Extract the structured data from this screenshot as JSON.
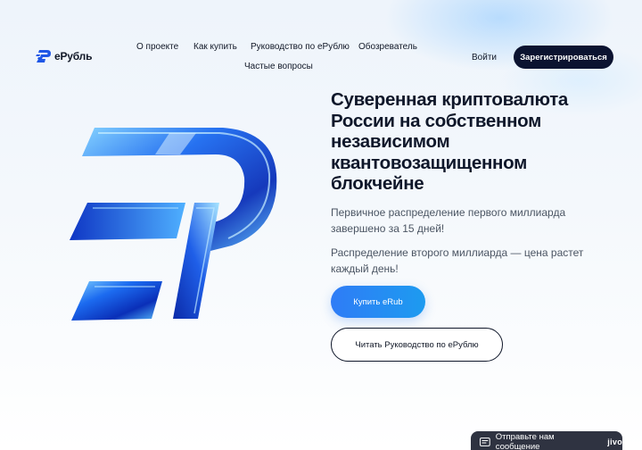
{
  "brand": {
    "name": "еРубль"
  },
  "nav": {
    "items": [
      {
        "label": "О проекте"
      },
      {
        "label": "Как купить"
      },
      {
        "label": "Руководство по еРублю"
      },
      {
        "label": "Обозреватель"
      },
      {
        "label": "Частые вопросы"
      }
    ],
    "login": "Войти",
    "register": "Зарегистрироваться"
  },
  "hero": {
    "headline": "Суверенная криптовалюта России на собственном независимом квантовозащищенном блокчейне",
    "paragraph1": "Первичное распределение первого миллиарда завершено за 15 дней!",
    "paragraph2": "Распределение второго миллиарда — цена растет каждый день!",
    "buy_button": "Купить eRub",
    "guide_button": "Читать Руководство по еРублю"
  },
  "chat_widget": {
    "label": "Отправьте нам сообщение",
    "brand": "jivo"
  },
  "colors": {
    "accent": "#2f7cf6",
    "dark": "#0b1330"
  }
}
